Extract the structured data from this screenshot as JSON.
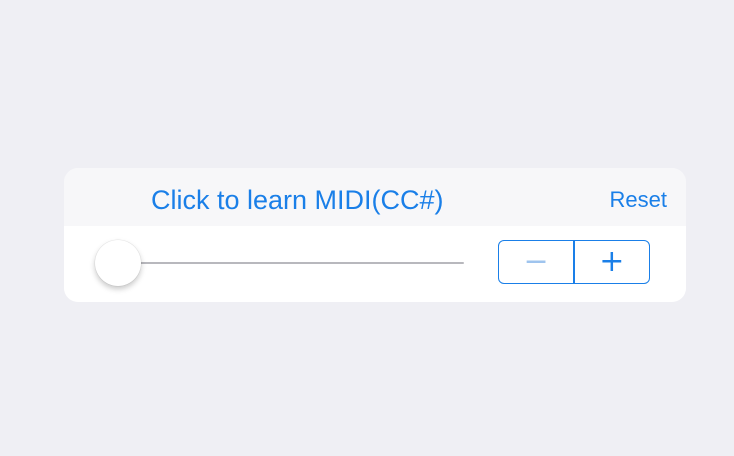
{
  "midi_panel": {
    "learn_label": "Click to learn MIDI(CC#)",
    "reset_label": "Reset"
  },
  "slider": {
    "value_fraction": 0.0
  },
  "stepper": {
    "decrement_symbol": "−",
    "increment_symbol": "+"
  },
  "colors": {
    "accent": "#1a7fe8",
    "background": "#efeff4",
    "panel_header": "#f7f7f9",
    "panel_body": "#ffffff",
    "track": "#b8b8bd"
  }
}
